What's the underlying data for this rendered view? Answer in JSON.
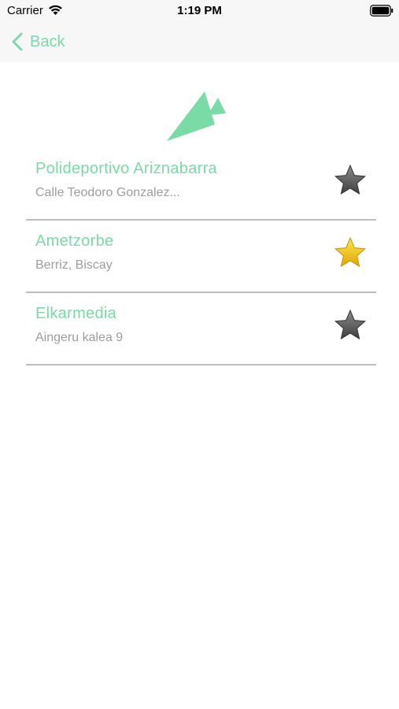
{
  "status_bar": {
    "carrier": "Carrier",
    "time": "1:19 PM",
    "icons": [
      "wifi-icon",
      "battery-icon"
    ]
  },
  "nav_bar": {
    "back_label": "Back",
    "back_icon": "chevron-left-icon"
  },
  "logo": {
    "icon": "mountain-logo-icon"
  },
  "venues": [
    {
      "name": "Polideportivo Ariznabarra",
      "address": "Calle Teodoro Gonzalez...",
      "favorite": false
    },
    {
      "name": "Ametzorbe",
      "address": "Berriz, Biscay",
      "favorite": true
    },
    {
      "name": "Elkarmedia",
      "address": "Aingeru kalea 9",
      "favorite": false
    }
  ],
  "colors": {
    "accent": "#7bdba6",
    "secondary_text": "#9e9e9e",
    "divider": "#bdbdbd",
    "star_inactive": "#555555",
    "star_active": "#f5c518"
  }
}
